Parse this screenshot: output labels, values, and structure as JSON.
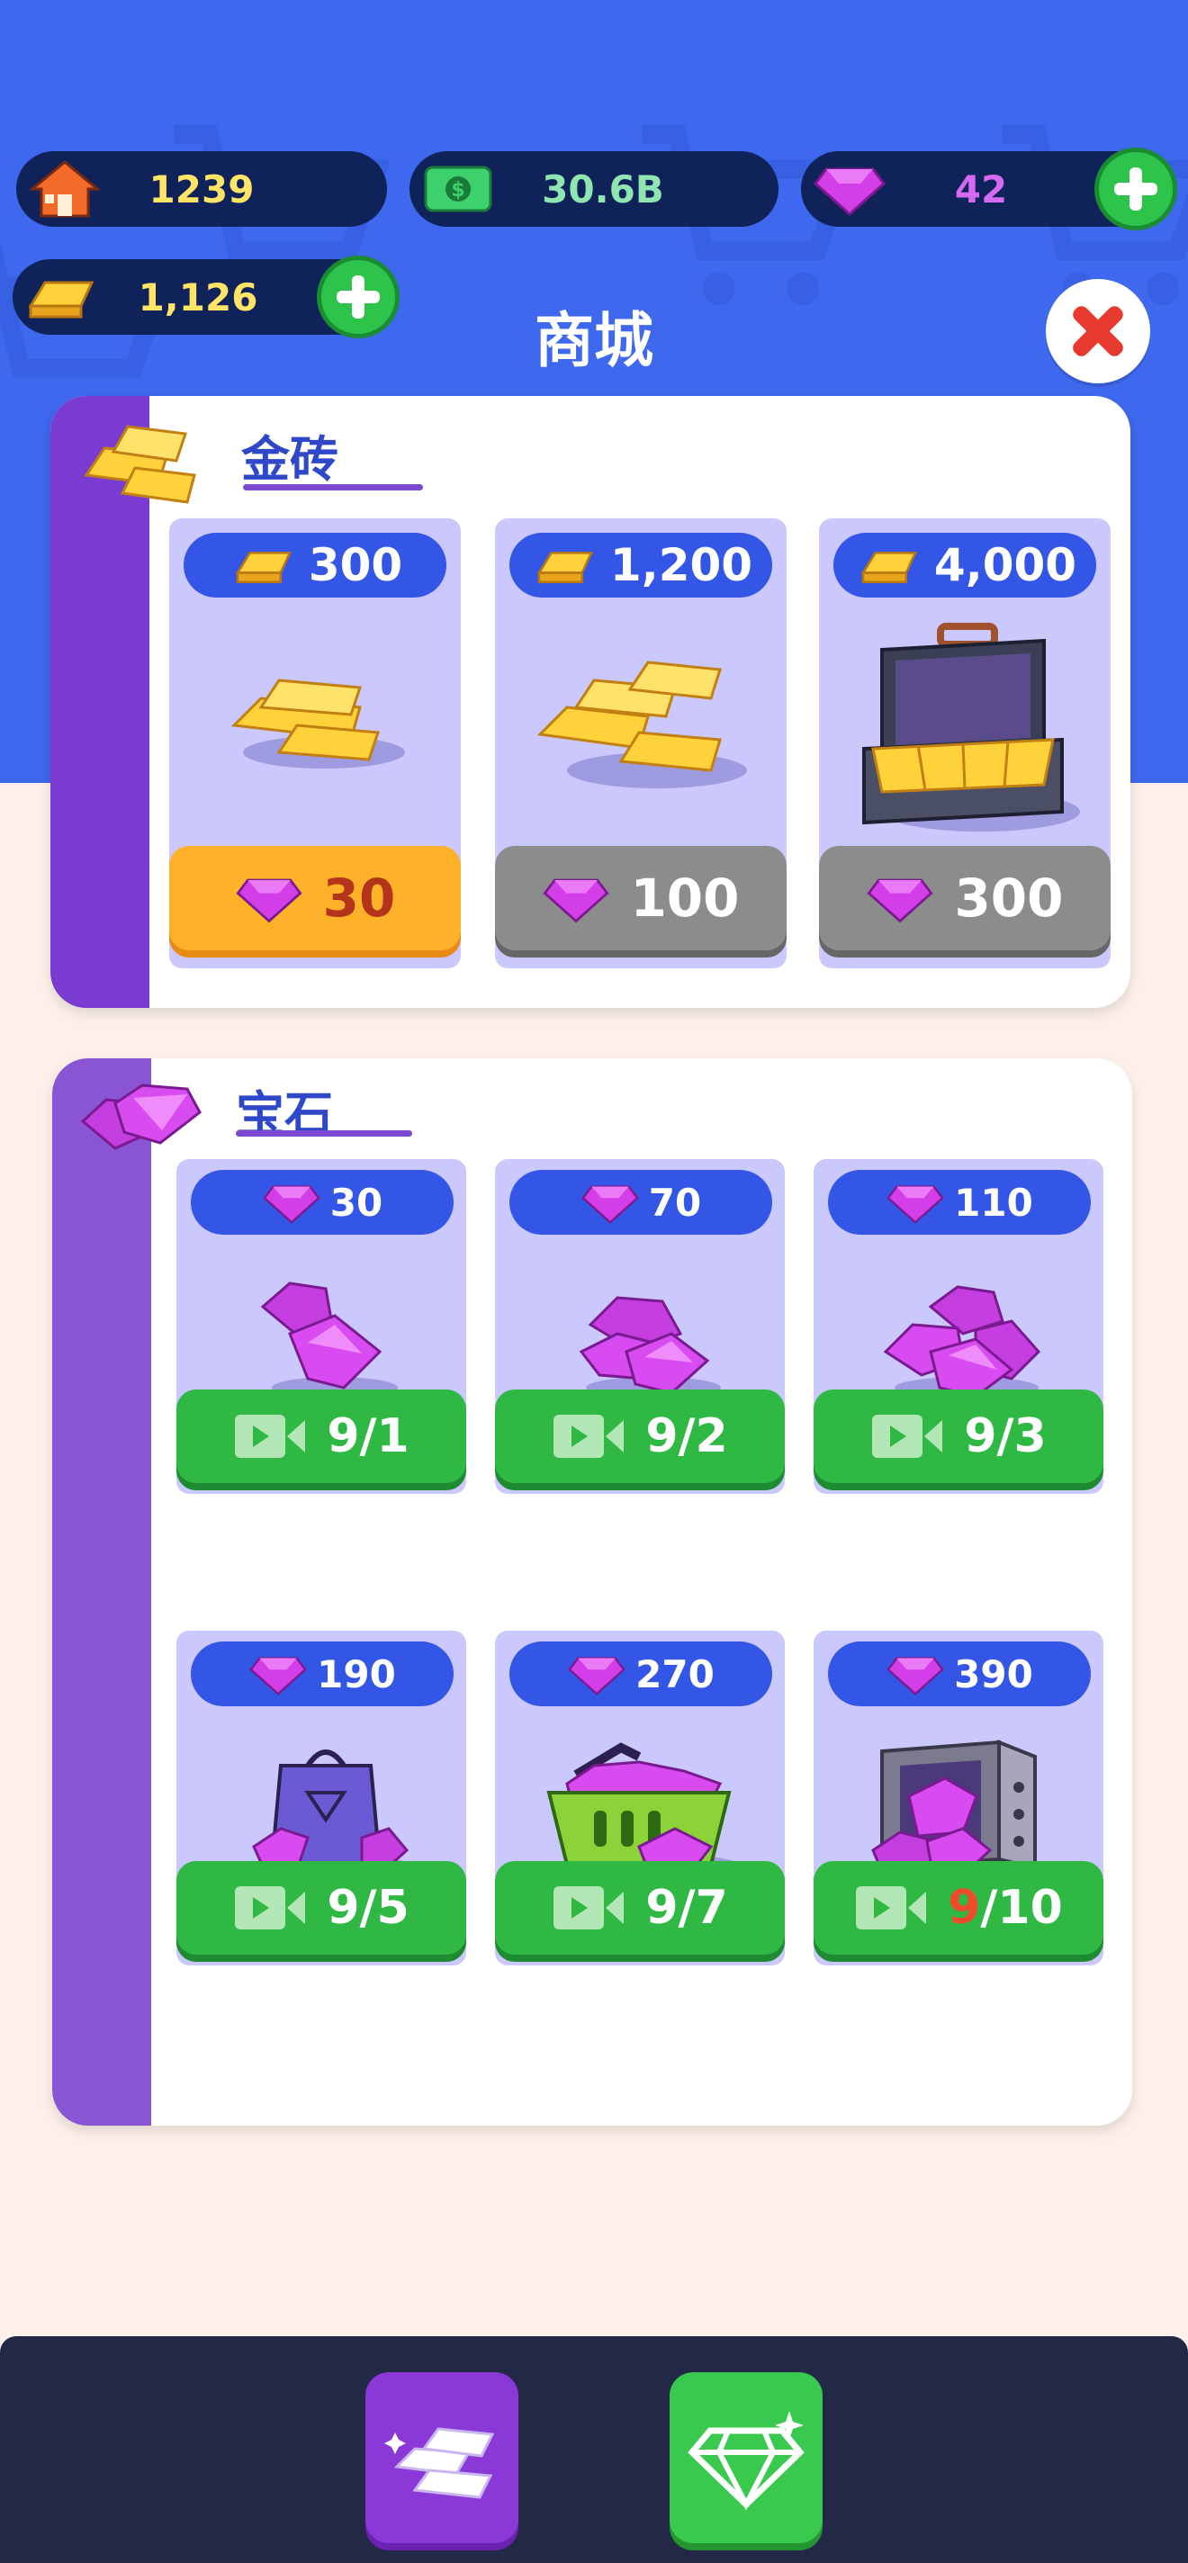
{
  "resources": {
    "home": "1239",
    "cash": "30.6B",
    "gems": "42",
    "gold": "1,126"
  },
  "header": {
    "title": "商城"
  },
  "gold_section": {
    "title": "金砖",
    "items": [
      {
        "amount": "300",
        "price": "30",
        "style": "gold"
      },
      {
        "amount": "1,200",
        "price": "100",
        "style": "grey"
      },
      {
        "amount": "4,000",
        "price": "300",
        "style": "grey"
      }
    ]
  },
  "gem_section": {
    "title": "宝石",
    "items": [
      {
        "amount": "30",
        "count": "9",
        "total": "/1"
      },
      {
        "amount": "70",
        "count": "9",
        "total": "/2"
      },
      {
        "amount": "110",
        "count": "9",
        "total": "/3"
      },
      {
        "amount": "190",
        "count": "9",
        "total": "/5"
      },
      {
        "amount": "270",
        "count": "9",
        "total": "/7"
      },
      {
        "amount": "390",
        "count": "9",
        "total": "/10"
      }
    ]
  },
  "colors": {
    "header_blue": "#3e68ee",
    "pill_navy": "#0f2259",
    "gold_text": "#ffe466",
    "cash_text": "#8fe6b0",
    "gem_text": "#d56af0",
    "green": "#2fb844",
    "purple": "#7a3bd1",
    "gem_magenta": "#c53ee0"
  },
  "icons": [
    "house-icon",
    "cash-icon",
    "gem-icon",
    "gold-bar-icon",
    "plus-icon",
    "close-icon",
    "video-icon",
    "gold-stack-tab-icon",
    "diamond-tab-icon"
  ]
}
